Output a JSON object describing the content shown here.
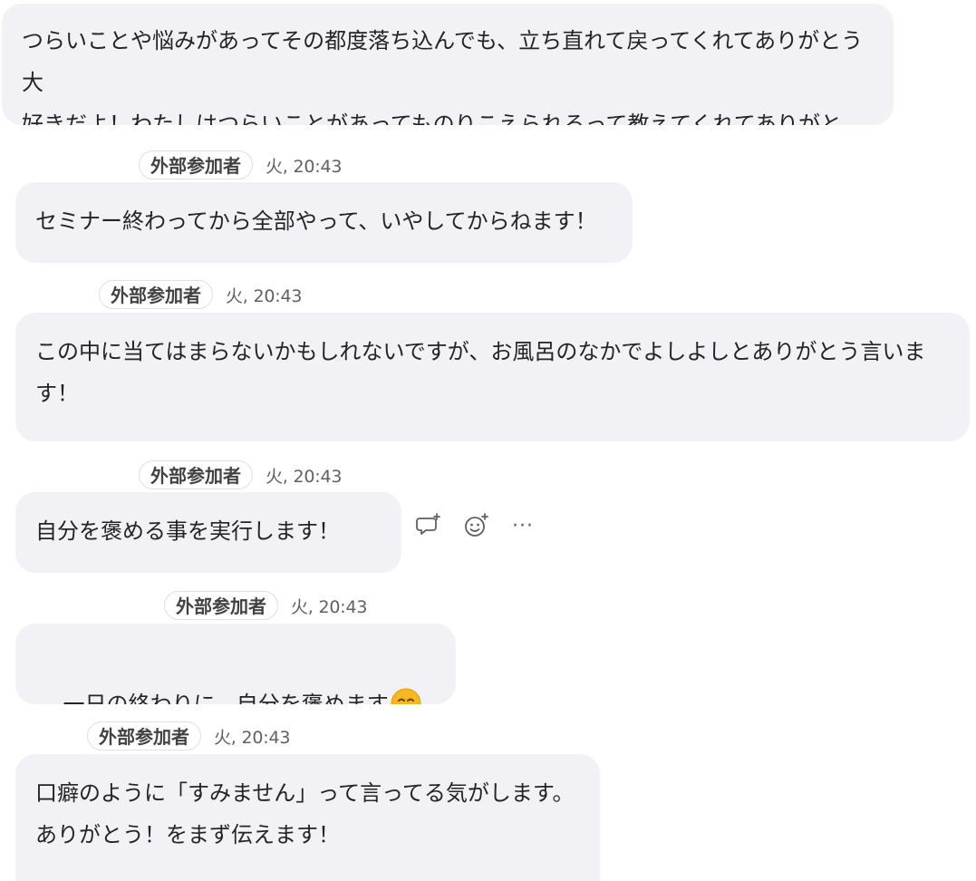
{
  "messages": [
    {
      "sender": "",
      "time": "",
      "text": "つらいことや悩みがあってその都度落ち込んでも、立ち直れて戻ってくれてありがとう大\n好きだよ！わたしはつらいことがあってものりこえられるって教えてくれてありがとう！"
    },
    {
      "sender": "外部参加者",
      "time": "火, 20:43",
      "text": "セミナー終わってから全部やって、いやしてからねます！"
    },
    {
      "sender": "外部参加者",
      "time": "火, 20:43",
      "text": "この中に当てはまらないかもしれないですが、お風呂のなかでよしよしとありがとう言いま\nす！"
    },
    {
      "sender": "外部参加者",
      "time": "火, 20:43",
      "text": "自分を褒める事を実行します！"
    },
    {
      "sender": "外部参加者",
      "time": "火, 20:43",
      "text": "一日の終わりに、自分を褒めます",
      "emoji": "smiling-face-emoji"
    },
    {
      "sender": "外部参加者",
      "time": "火, 20:43",
      "text": "口癖のように「すみません」って言ってる気がします。\nありがとう！をまず伝えます！"
    }
  ],
  "hover_actions": {
    "reply_icon": "reply-icon",
    "react_icon": "add-reaction-icon",
    "more_icon": "more-options-icon",
    "more_label": "···"
  },
  "colors": {
    "bubble_bg": "#f2f2f6",
    "pill_border": "#dedee6",
    "timestamp": "#616161",
    "emoji": "#f5b820"
  }
}
